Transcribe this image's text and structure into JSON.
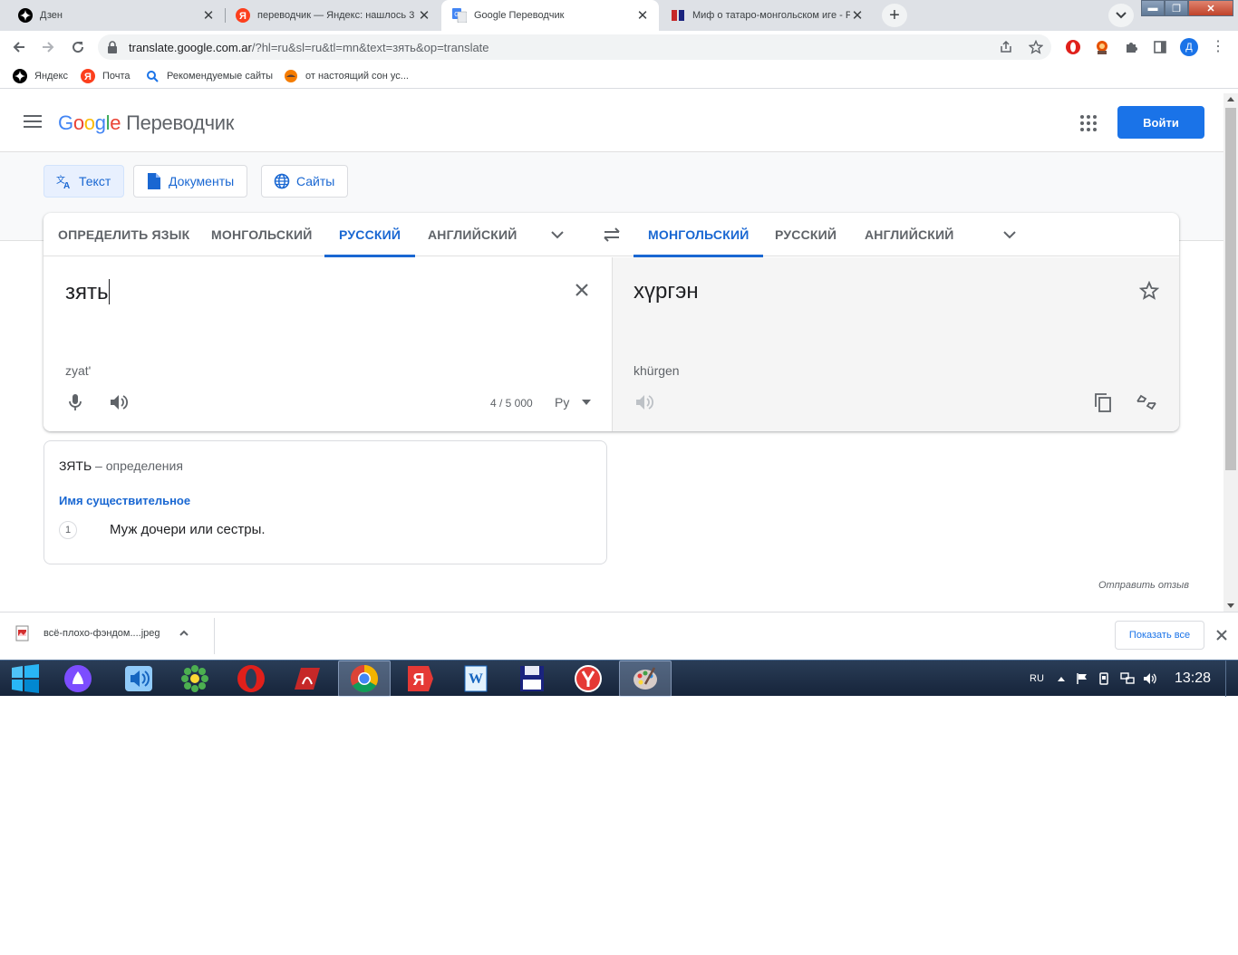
{
  "browser": {
    "tabs": [
      {
        "title": "Дзен",
        "active": false
      },
      {
        "title": "переводчик — Яндекс: нашлось 3",
        "active": false
      },
      {
        "title": "Google Переводчик",
        "active": true
      },
      {
        "title": "Миф о татаро-монгольском иге - Р",
        "active": false
      }
    ],
    "url": {
      "host": "translate.google.com.ar",
      "path": "/?hl=ru&sl=ru&tl=mn&text=зять&op=translate"
    },
    "profile_initial": "Д",
    "bookmarks": [
      {
        "label": "Яндекс"
      },
      {
        "label": "Почта"
      },
      {
        "label": "Рекомендуемые сайты"
      },
      {
        "label": "от настоящий сон ус..."
      }
    ]
  },
  "header": {
    "logo": [
      "G",
      "o",
      "o",
      "g",
      "l",
      "e"
    ],
    "product": "Переводчик",
    "signin": "Войти"
  },
  "modes": [
    {
      "label": "Текст",
      "active": true
    },
    {
      "label": "Документы",
      "active": false
    },
    {
      "label": "Сайты",
      "active": false
    }
  ],
  "source_langs": [
    "ОПРЕДЕЛИТЬ ЯЗЫК",
    "МОНГОЛЬСКИЙ",
    "РУССКИЙ",
    "АНГЛИЙСКИЙ"
  ],
  "target_langs": [
    "МОНГОЛЬСКИЙ",
    "РУССКИЙ",
    "АНГЛИЙСКИЙ"
  ],
  "source": {
    "text": "зять",
    "transliteration": "zyat'",
    "counter": "4 / 5 000",
    "keyboard": "Ру"
  },
  "target": {
    "text": "хүргэн",
    "transliteration": "khürgen"
  },
  "definitions": {
    "word": "ЗЯТЬ",
    "dash": "– определения",
    "pos": "Имя существительное",
    "items": [
      {
        "num": "1",
        "text": "Муж дочери или сестры."
      }
    ]
  },
  "feedback": "Отправить отзыв",
  "downloads": {
    "file": "всё-плохо-фэндом....jpeg",
    "show_all": "Показать все"
  },
  "taskbar": {
    "lang": "RU",
    "time": "13:28"
  },
  "colors": {
    "accent": "#1a73e8",
    "selected_lang": "#1967d2"
  }
}
